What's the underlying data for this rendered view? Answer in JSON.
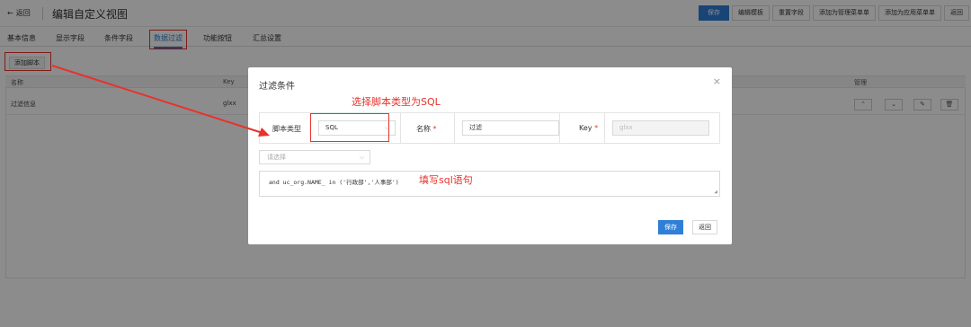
{
  "header": {
    "back_label": "返回",
    "title": "编辑自定义视图",
    "toolbar": [
      "保存",
      "编辑模板",
      "重置字段",
      "添加为管理菜单单",
      "添加为应用菜单单",
      "返回"
    ]
  },
  "tabs": [
    "基本信息",
    "显示字段",
    "条件字段",
    "数据过滤",
    "功能按钮",
    "汇总设置"
  ],
  "active_tab": "数据过滤",
  "add_script_label": "添加脚本",
  "table": {
    "headers": [
      "名称",
      "Key",
      "管理"
    ],
    "rows": [
      {
        "name": "过滤信息",
        "key": "glxx"
      }
    ],
    "ops": [
      "⌃",
      "⌄",
      "✎",
      "🗑"
    ]
  },
  "modal": {
    "title": "过滤条件",
    "close": "×",
    "script_type_label": "脚本类型",
    "script_type_value": "SQL",
    "name_label": "名称",
    "name_value": "过滤",
    "key_label": "Key",
    "key_value": "glxx",
    "required_mark": "*",
    "select_placeholder": "请选择",
    "sql_text": "and uc_org.NAME_ in ('行政部','人事部')",
    "save_label": "保存",
    "cancel_label": "返回"
  },
  "annotations": {
    "select_sql": "选择脚本类型为SQL",
    "write_sql": "填写sql语句"
  },
  "colors": {
    "accent": "#2f7fd7",
    "annotation_red": "#e8322c"
  }
}
